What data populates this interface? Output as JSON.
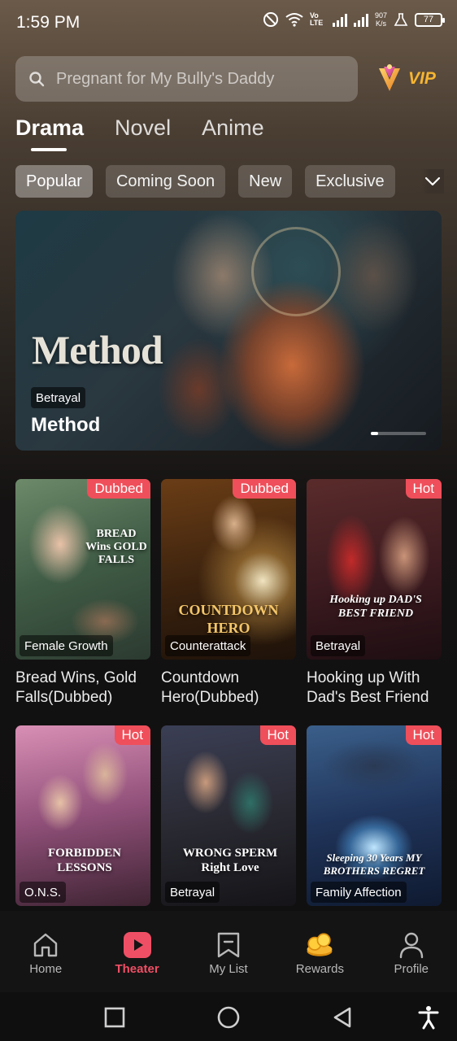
{
  "status_bar": {
    "time": "1:59 PM",
    "net_speed_value": "907",
    "net_speed_unit": "K/s",
    "lte_label": "Vo LTE",
    "battery": "77"
  },
  "search": {
    "placeholder": "Pregnant for My Bully's Daddy"
  },
  "vip": {
    "label": "VIP"
  },
  "main_tabs": [
    {
      "label": "Drama",
      "active": true
    },
    {
      "label": "Novel",
      "active": false
    },
    {
      "label": "Anime",
      "active": false
    }
  ],
  "filter_chips": [
    {
      "label": "Popular",
      "active": true
    },
    {
      "label": "Coming Soon",
      "active": false
    },
    {
      "label": "New",
      "active": false
    },
    {
      "label": "Exclusive",
      "active": false
    }
  ],
  "banner": {
    "logo_text": "Method",
    "tag": "Betrayal",
    "title": "Method",
    "carousel_position": 1
  },
  "cards": [
    {
      "badge": "Dubbed",
      "tag": "Female Growth",
      "title": "Bread Wins, Gold Falls(Dubbed)",
      "poster_text": "BREAD Wins GOLD FALLS"
    },
    {
      "badge": "Dubbed",
      "tag": "Counterattack",
      "title": "Countdown Hero(Dubbed)",
      "poster_text": "COUNTDOWN HERO"
    },
    {
      "badge": "Hot",
      "tag": "Betrayal",
      "title": "Hooking up With Dad's Best Friend",
      "poster_text": "Hooking up DAD'S BEST FRIEND"
    },
    {
      "badge": "Hot",
      "tag": "O.N.S.",
      "title": "",
      "poster_text": "FORBIDDEN LESSONS"
    },
    {
      "badge": "Hot",
      "tag": "Betrayal",
      "title": "",
      "poster_text": "WRONG SPERM Right Love"
    },
    {
      "badge": "Hot",
      "tag": "Family Affection",
      "title": "",
      "poster_text": "Sleeping 30 Years MY BROTHERS REGRET"
    }
  ],
  "bottom_nav": [
    {
      "label": "Home",
      "icon": "home-icon",
      "active": false
    },
    {
      "label": "Theater",
      "icon": "play-icon",
      "active": true
    },
    {
      "label": "My List",
      "icon": "bookmark-icon",
      "active": false
    },
    {
      "label": "Rewards",
      "icon": "gold-coins-icon",
      "active": false
    },
    {
      "label": "Profile",
      "icon": "profile-icon",
      "active": false
    }
  ],
  "colors": {
    "accent": "#ef4f65",
    "badge": "#ef4f5a",
    "vip": "#f6b531"
  }
}
